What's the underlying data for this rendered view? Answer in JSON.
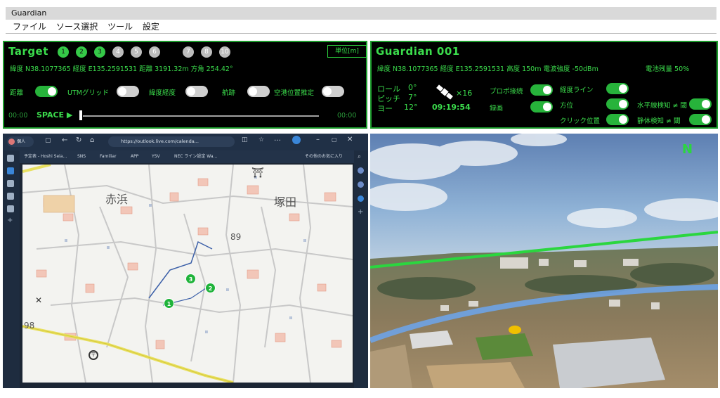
{
  "window": {
    "title": "Guardian"
  },
  "menu": [
    "ファイル",
    "ソース選択",
    "ツール",
    "設定"
  ],
  "target": {
    "title": "Target",
    "circles": [
      {
        "label": "1",
        "state": "on"
      },
      {
        "label": "2",
        "state": "on"
      },
      {
        "label": "3",
        "state": "on"
      },
      {
        "label": "4",
        "state": "off"
      },
      {
        "label": "5",
        "state": "off"
      },
      {
        "label": "6",
        "state": "off"
      },
      {
        "label": "7",
        "state": "off"
      },
      {
        "label": "8",
        "state": "off"
      },
      {
        "label": "10",
        "state": "off"
      }
    ],
    "unit_button": "単位[m]",
    "info_line": "緯度 N38.1077365 経度 E135.2591531 距離 3191.32m 方角 254.42°",
    "toggles": [
      {
        "label": "距離",
        "on": true
      },
      {
        "label": "UTMグリッド",
        "on": false
      },
      {
        "label": "緯度経度",
        "on": false
      },
      {
        "label": "航跡",
        "on": false
      },
      {
        "label": "空港位置推定",
        "on": false
      }
    ],
    "time_start": "00:00",
    "play_label": "SPACE ▶",
    "time_end": "00:00",
    "progress": 0
  },
  "guardian": {
    "title": "Guardian 001",
    "info_line": "緯度 N38.1077365 経度 E135.2591531 高度 150m 電波強度 -50dBm",
    "battery": "電池残量 50%",
    "roll_label": "ロール",
    "roll_value": "0°",
    "pitch_label": "ピッチ",
    "pitch_value": "7°",
    "yaw_label": "ヨー",
    "yaw_value": "12°",
    "satellites": "×16",
    "clock": "09:19:54",
    "toggles_mid": [
      {
        "label": "プロポ接続",
        "on": true
      },
      {
        "label": "録画",
        "on": true
      }
    ],
    "toggles_right": [
      {
        "label": "経度ライン",
        "on": true
      },
      {
        "label": "方位",
        "on": true
      },
      {
        "label": "クリック位置",
        "on": true
      }
    ],
    "toggles_far": [
      {
        "label": "水平線検知 ≠ 閾",
        "on": true
      },
      {
        "label": "静体検知 ≠ 閾",
        "on": true
      }
    ]
  },
  "browser": {
    "profile": "個人",
    "url": "https://outlook.live.com/calenda...",
    "bookmarks": [
      "予定表 - Hoshi Seia...",
      "SNS",
      "Familiar",
      "APP",
      "YSV",
      "NEC ライン設定 Wa...",
      "その他のお気に入り"
    ],
    "map_labels": [
      "赤浜",
      "塚田",
      "89",
      "98"
    ],
    "markers": [
      "1",
      "2",
      "3"
    ]
  },
  "camera": {
    "compass": "N"
  }
}
